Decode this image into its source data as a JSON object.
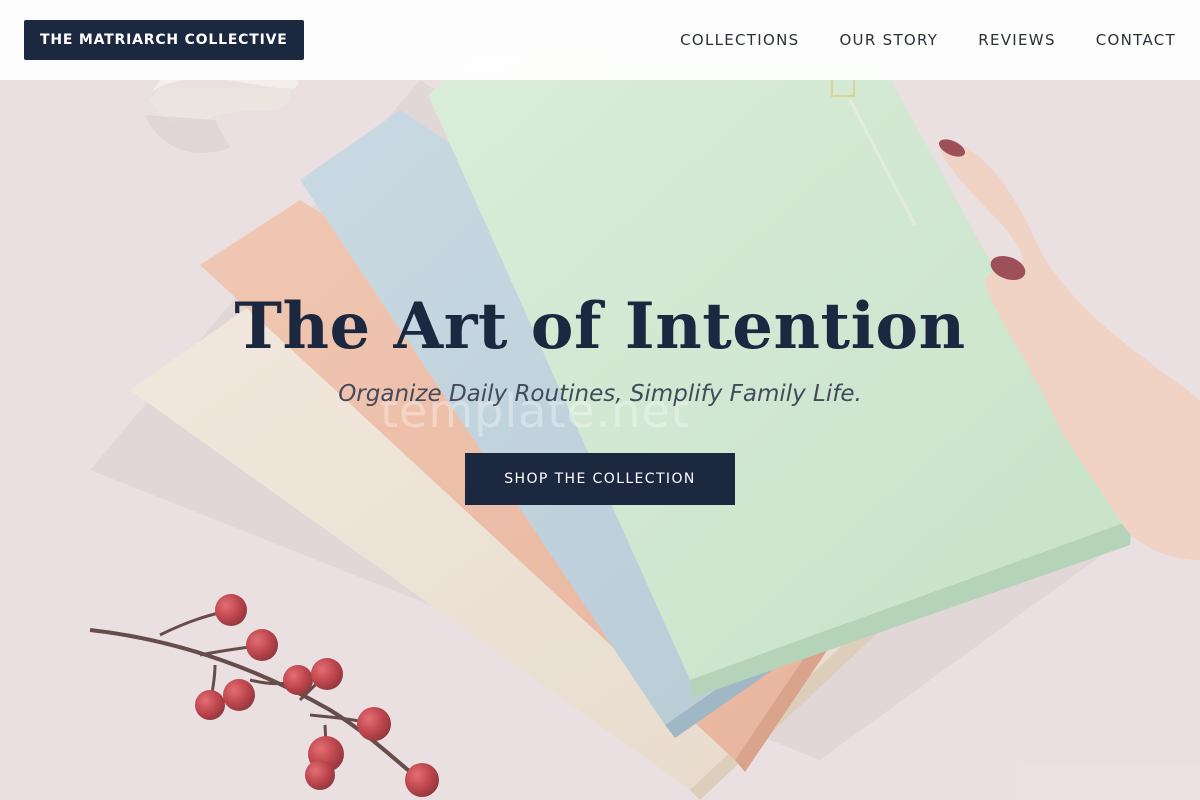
{
  "header": {
    "brand": "THE MATRIARCH COLLECTIVE",
    "nav": [
      {
        "label": "COLLECTIONS"
      },
      {
        "label": "OUR STORY"
      },
      {
        "label": "REVIEWS"
      },
      {
        "label": "CONTACT"
      }
    ]
  },
  "hero": {
    "title": "The Art of Intention",
    "subtitle": "Organize Daily Routines, Simplify Family Life.",
    "cta_label": "SHOP THE COLLECTION",
    "watermark": "template.net"
  },
  "colors": {
    "brand_navy": "#1c2740",
    "background_pink": "#eadfe0",
    "notebook_green": "#cfe8cf",
    "notebook_blue": "#b8cfdc",
    "notebook_peach": "#edb89f",
    "notebook_cream": "#efe3d3",
    "berry_red": "#b3212a"
  }
}
